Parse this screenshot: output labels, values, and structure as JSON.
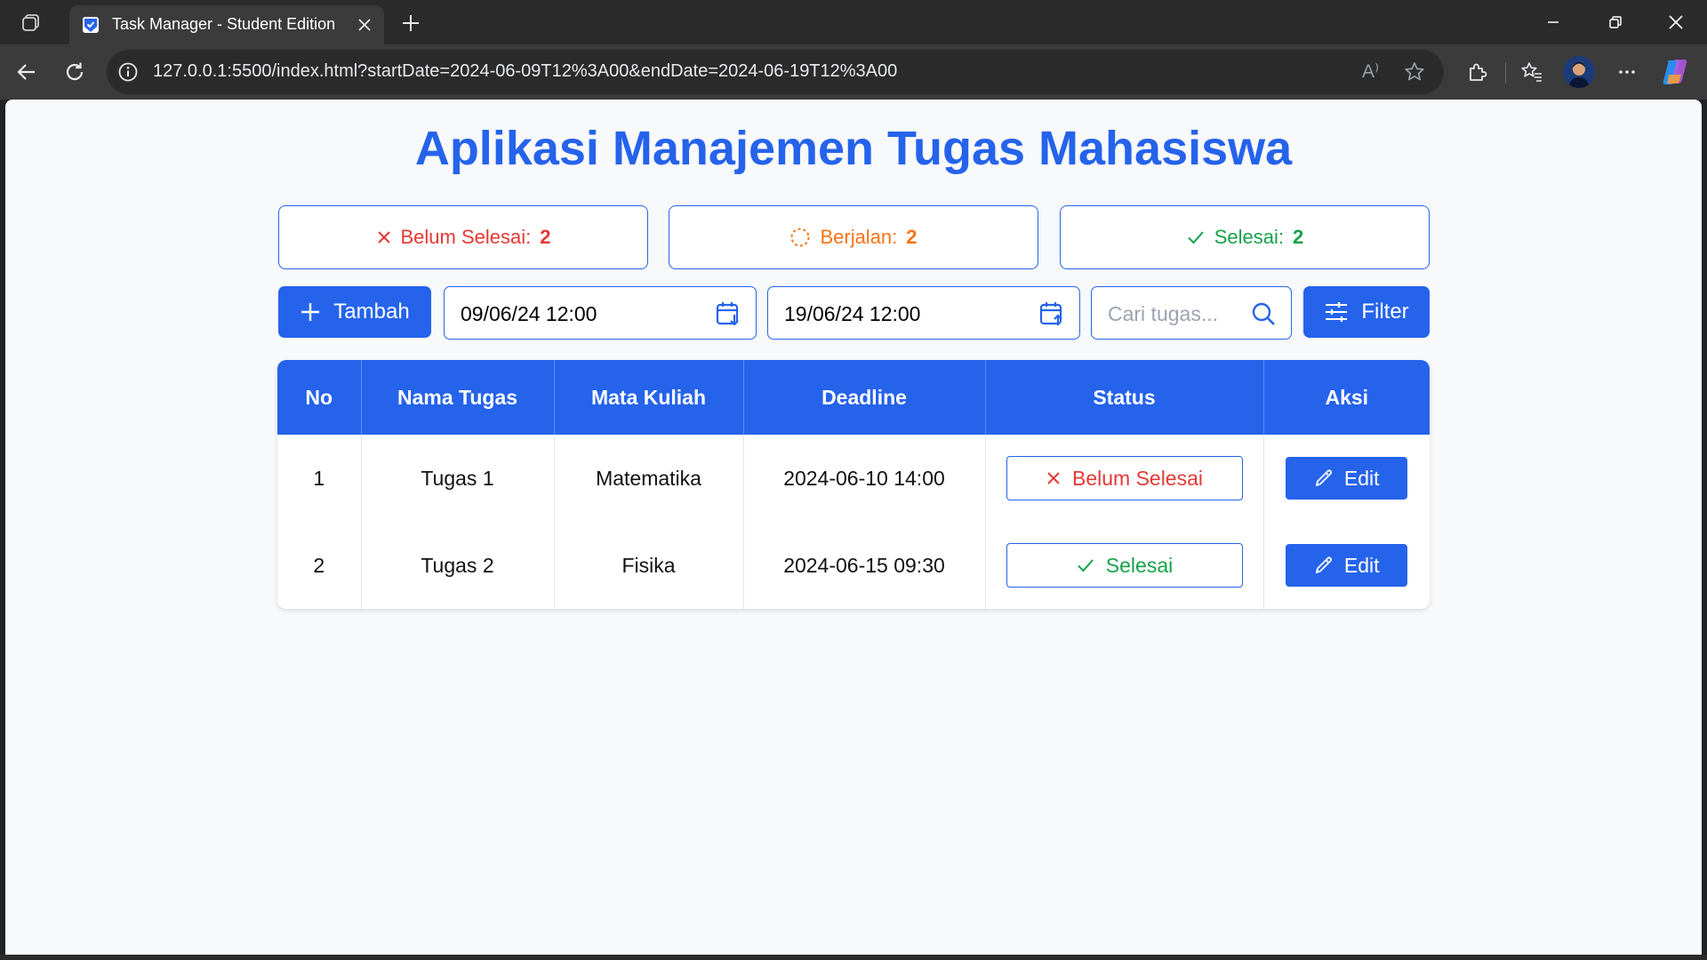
{
  "browser": {
    "tab_title": "Task Manager - Student Edition",
    "url": "127.0.0.1:5500/index.html?startDate=2024-06-09T12%3A00&endDate=2024-06-19T12%3A00",
    "read_aloud_label": "A⁾"
  },
  "app": {
    "title": "Aplikasi Manajemen Tugas Mahasiswa",
    "stats": {
      "belum": {
        "label": "Belum Selesai:",
        "count": "2",
        "color": "#e53935"
      },
      "berjalan": {
        "label": "Berjalan:",
        "count": "2",
        "color": "#f97316"
      },
      "selesai": {
        "label": "Selesai:",
        "count": "2",
        "color": "#16a34a"
      }
    },
    "controls": {
      "add_label": "Tambah",
      "start_date": "09/06/24 12:00",
      "end_date": "19/06/24 12:00",
      "search_placeholder": "Cari tugas...",
      "filter_label": "Filter"
    },
    "table": {
      "headers": [
        "No",
        "Nama Tugas",
        "Mata Kuliah",
        "Deadline",
        "Status",
        "Aksi"
      ],
      "rows": [
        {
          "no": "1",
          "nama": "Tugas 1",
          "matkul": "Matematika",
          "deadline": "2024-06-10 14:00",
          "status": "Belum Selesai",
          "aksi": "Edit"
        },
        {
          "no": "2",
          "nama": "Tugas 2",
          "matkul": "Fisika",
          "deadline": "2024-06-15 09:30",
          "status": "Selesai",
          "aksi": "Edit"
        }
      ]
    },
    "colors": {
      "primary": "#2563eb",
      "page_bg": "#f8f9fb"
    }
  }
}
